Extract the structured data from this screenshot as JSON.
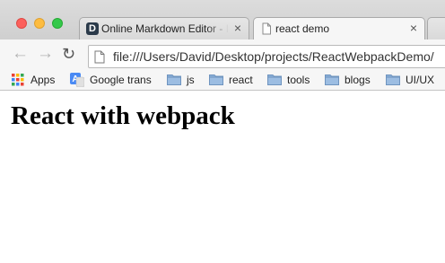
{
  "tabs": [
    {
      "title": "Online Markdown Editor - I",
      "favicon": "D",
      "close": "×",
      "active": false
    },
    {
      "title": "react demo",
      "close": "×",
      "active": true
    }
  ],
  "toolbar": {
    "back_icon": "arrow-left-icon",
    "forward_icon": "arrow-right-icon",
    "reload_icon": "reload-icon",
    "url": "file:///Users/David/Desktop/projects/ReactWebpackDemo/"
  },
  "bookmarks": [
    {
      "label": "Apps",
      "icon": "apps-grid-icon"
    },
    {
      "label": "Google trans",
      "icon": "google-translate-icon"
    },
    {
      "label": "js",
      "icon": "folder-icon"
    },
    {
      "label": "react",
      "icon": "folder-icon"
    },
    {
      "label": "tools",
      "icon": "folder-icon"
    },
    {
      "label": "blogs",
      "icon": "folder-icon"
    },
    {
      "label": "UI/UX",
      "icon": "folder-icon"
    }
  ],
  "page": {
    "heading": "React with webpack"
  },
  "colors": {
    "close_button": "#fc605c",
    "minimize_button": "#fdbc40",
    "maximize_button": "#34c84a",
    "folder": "#8aafd8",
    "google_translate": "#4a8af4"
  }
}
